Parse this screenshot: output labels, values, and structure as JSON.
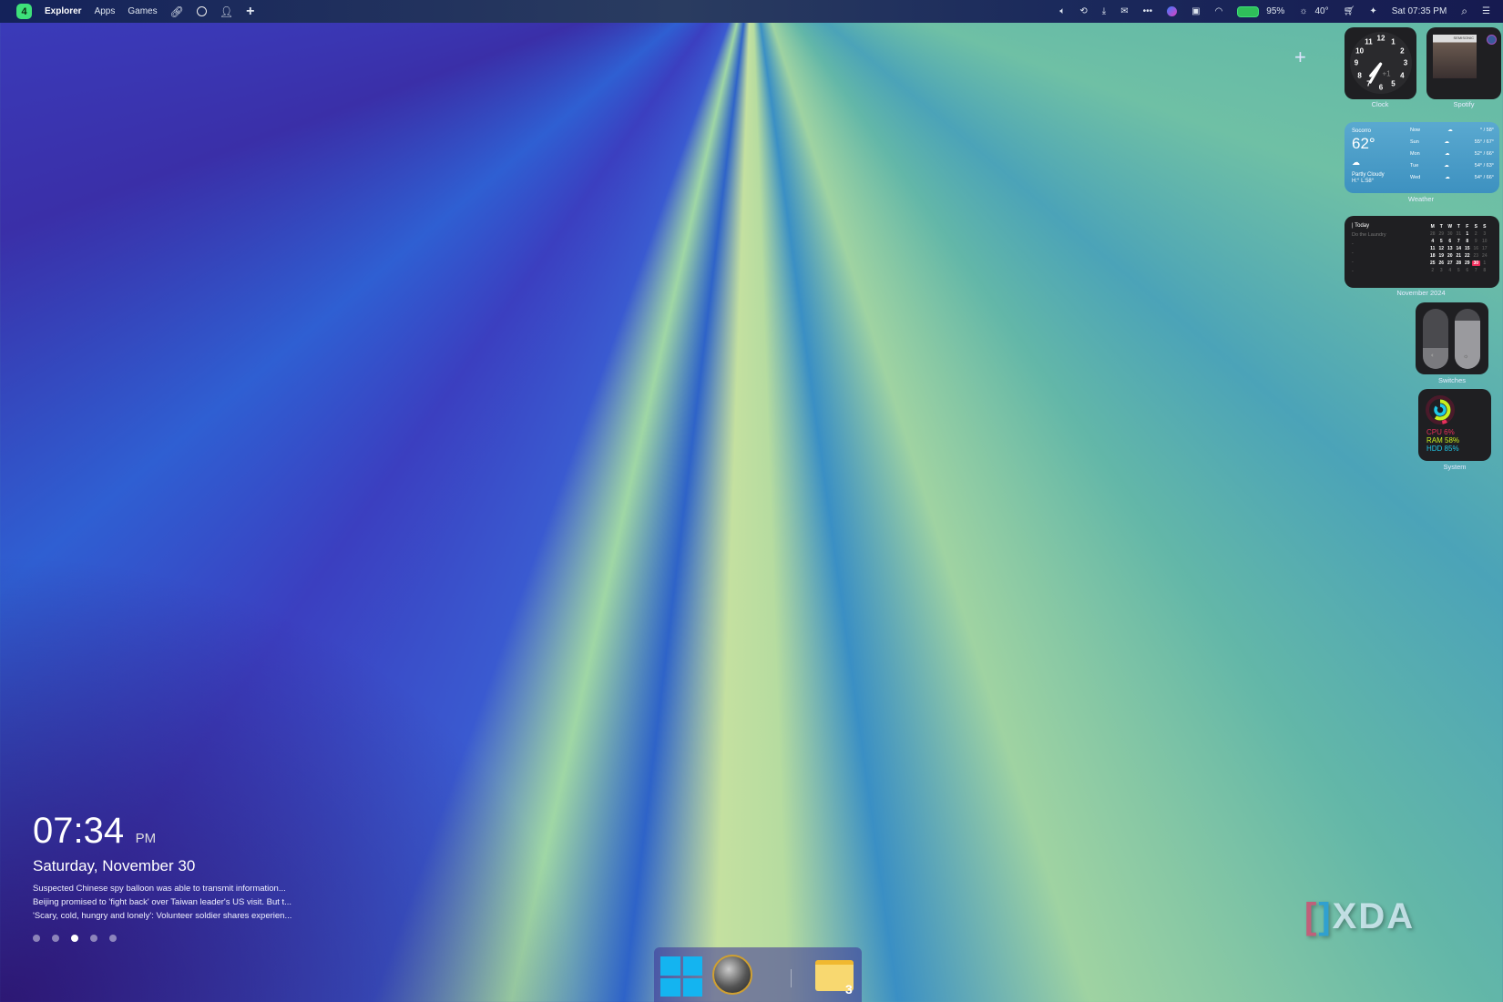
{
  "menubar": {
    "workspace": "4",
    "items": [
      "Explorer",
      "Apps",
      "Games"
    ],
    "battery": "95%",
    "weather_temp": "40°",
    "datetime": "Sat 07:35 PM"
  },
  "widgets": {
    "add": "+",
    "clock": {
      "label": "Clock",
      "numbers": [
        "12",
        "1",
        "2",
        "3",
        "4",
        "5",
        "6",
        "7",
        "8",
        "9",
        "10",
        "11"
      ],
      "offset": "+1"
    },
    "spotify": {
      "label": "Spotify",
      "album_text": "SEMISONIC"
    },
    "weather": {
      "label": "Weather",
      "city": "Socorro",
      "temp": "62°",
      "condition": "Partly Cloudy",
      "hilo": "H:° L:58°",
      "forecast": [
        {
          "day": "Now",
          "temps": "° / 58°"
        },
        {
          "day": "Sun",
          "temps": "55° / 67°"
        },
        {
          "day": "Mon",
          "temps": "52° / 66°"
        },
        {
          "day": "Tue",
          "temps": "54° / 63°"
        },
        {
          "day": "Wed",
          "temps": "54° / 66°"
        }
      ]
    },
    "calendar": {
      "label": "November 2024",
      "today": "| Today",
      "task": "Do the Laundry",
      "placeholders": [
        "-",
        "-",
        "-",
        "-"
      ],
      "weekdays": [
        "M",
        "T",
        "W",
        "T",
        "F",
        "S",
        "S"
      ],
      "days": [
        "28",
        "29",
        "30",
        "31",
        "1",
        "2",
        "3",
        "4",
        "5",
        "6",
        "7",
        "8",
        "9",
        "10",
        "11",
        "12",
        "13",
        "14",
        "15",
        "16",
        "17",
        "18",
        "19",
        "20",
        "21",
        "22",
        "23",
        "24",
        "25",
        "26",
        "27",
        "28",
        "29",
        "30",
        "1",
        "2",
        "3",
        "4",
        "5",
        "6",
        "7",
        "8"
      ]
    },
    "switches": {
      "label": "Switches"
    },
    "system": {
      "label": "System",
      "cpu": "CPU 6%",
      "ram": "RAM 58%",
      "hdd": "HDD 85%",
      "colors": {
        "cpu": "#e8305a",
        "ram": "#c8f020",
        "hdd": "#20c8e8"
      }
    }
  },
  "lockinfo": {
    "time": "07:34",
    "ampm": "PM",
    "date": "Saturday, November 30",
    "news": [
      "Suspected Chinese spy balloon was able to transmit information...",
      "Beijing promised to 'fight back' over Taiwan leader's US visit. But t...",
      "'Scary, cold, hungry and lonely': Volunteer soldier shares experien..."
    ],
    "page_count": 5,
    "active_page": 3
  },
  "dock": {
    "folder_badge": "3"
  },
  "watermark": "XDA"
}
